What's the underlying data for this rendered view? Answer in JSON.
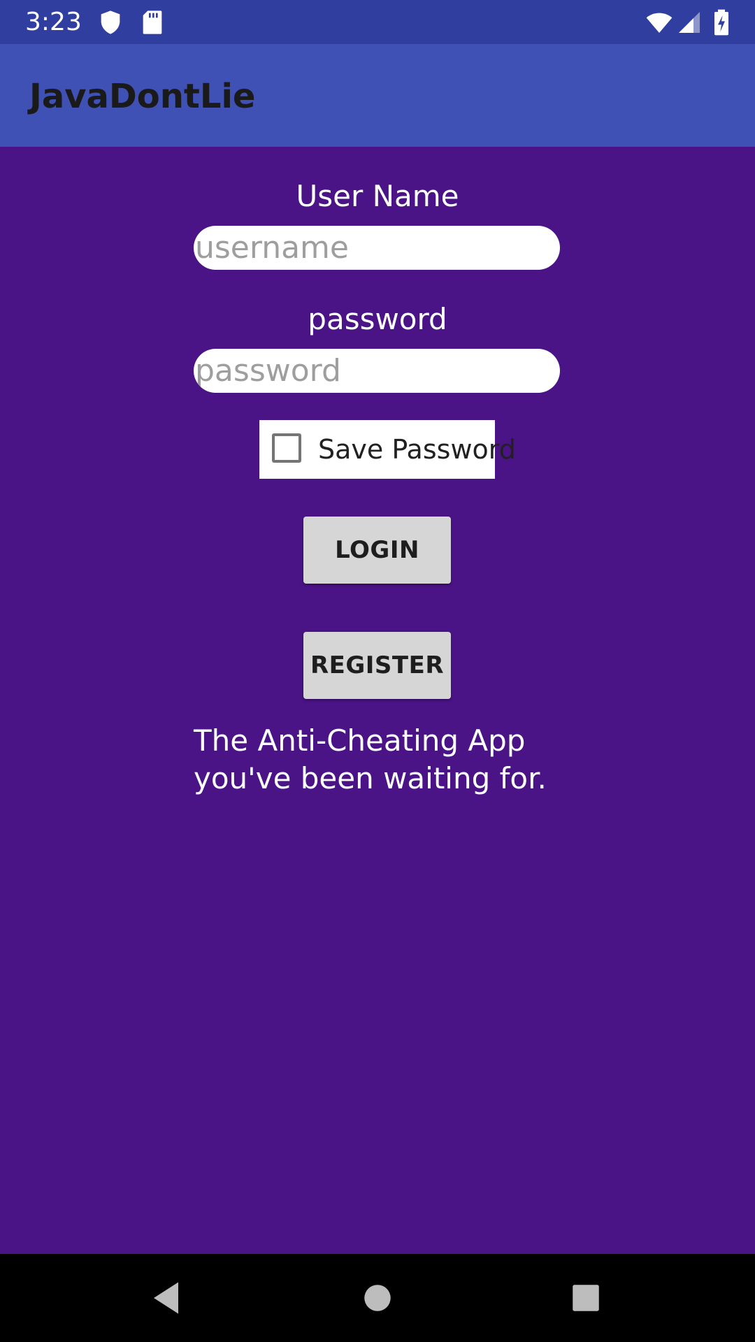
{
  "status_bar": {
    "time": "3:23",
    "icons": [
      "shield-icon",
      "sd-card-icon",
      "wifi-icon",
      "signal-icon",
      "battery-charging-icon"
    ]
  },
  "app_bar": {
    "title": "JavaDontLie"
  },
  "form": {
    "username_label": "User Name",
    "username_placeholder": "username",
    "username_value": "",
    "password_label": "password",
    "password_placeholder": "password",
    "password_value": "",
    "save_password_label": "Save Password",
    "save_password_checked": false,
    "login_label": "LOGIN",
    "register_label": "REGISTER"
  },
  "tagline": {
    "line1": "The Anti-Cheating App",
    "line2": "you've been waiting for."
  },
  "nav_bar": {
    "icons": [
      "back-icon",
      "home-icon",
      "recents-icon"
    ]
  },
  "colors": {
    "status_bar": "#303f9f",
    "app_bar": "#3f51b5",
    "background": "#4a1386",
    "button": "#d6d6d6"
  }
}
